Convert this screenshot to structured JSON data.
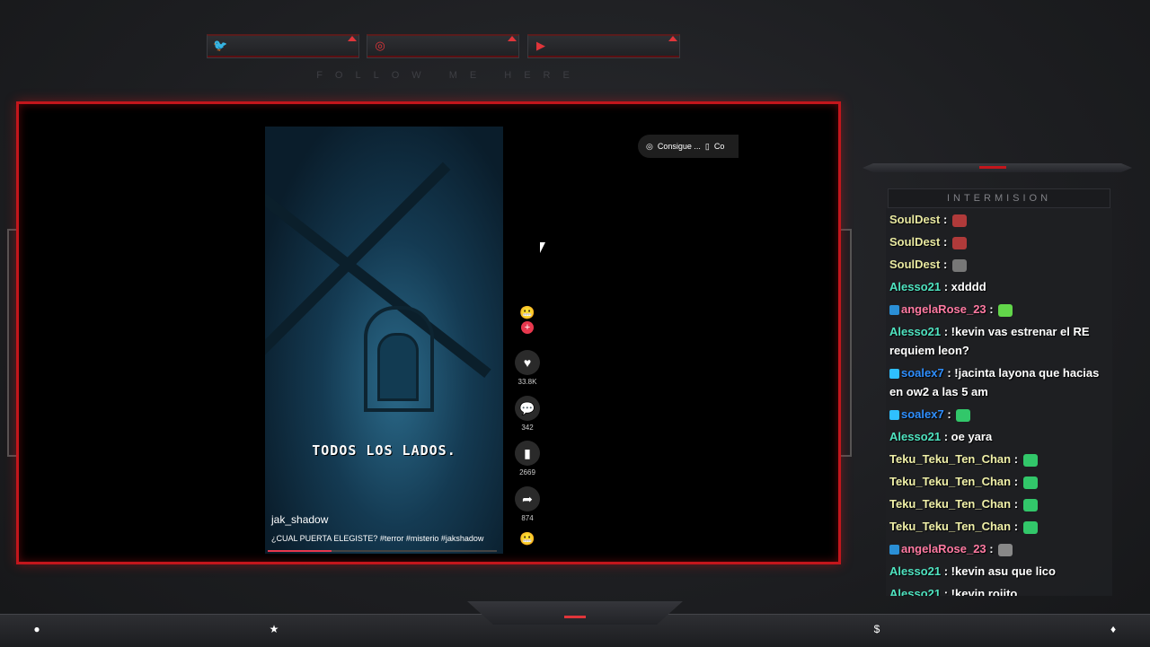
{
  "colors": {
    "frame": "#c3161c",
    "accent": "#e0353a"
  },
  "social": {
    "twitter_icon": "twitter-icon",
    "instagram_icon": "instagram-icon",
    "youtube_icon": "youtube-icon",
    "follow_label": "FOLLOW ME HERE"
  },
  "video": {
    "caption": "TODOS LOS LADOS.",
    "author": "jak_shadow",
    "description": "¿CUAL PUERTA ELEGISTE? #terror #misterio #jakshadow",
    "progress": 0.28,
    "likes": "33.8K",
    "comments": "342",
    "saves": "2669",
    "shares": "874",
    "get_app_label": "Consigue ...",
    "cut_label": "Co"
  },
  "panel": {
    "title": "INTERMISION"
  },
  "chat": [
    {
      "user": "SoulDest",
      "text": "",
      "color": "#e8e8a0",
      "emote": "#b03a3a"
    },
    {
      "user": "SoulDest",
      "text": "",
      "color": "#e8e8a0",
      "emote": "#b03a3a"
    },
    {
      "user": "SoulDest",
      "text": "",
      "color": "#e8e8a0",
      "emote": "#777777"
    },
    {
      "user": "Alesso21",
      "text": "xdddd",
      "color": "#4fe3c0"
    },
    {
      "user": "angelaRose_23",
      "text": "",
      "color": "#ff7aa2",
      "emote": "#62d64a",
      "badge": "#2a8fd6"
    },
    {
      "user": "Alesso21",
      "text": "!kevin vas estrenar el RE requiem leon?",
      "color": "#4fe3c0"
    },
    {
      "user": "soalex7",
      "text": "!jacinta layona que hacias en ow2 a las 5 am",
      "color": "#2f8fff",
      "badge": "#2fc0ff"
    },
    {
      "user": "soalex7",
      "text": "",
      "color": "#2f8fff",
      "badge": "#2fc0ff",
      "emote": "#32c76a"
    },
    {
      "user": "Alesso21",
      "text": "oe yara",
      "color": "#4fe3c0"
    },
    {
      "user": "Teku_Teku_Ten_Chan",
      "text": "",
      "color": "#f0f0a8",
      "emote": "#32c76a"
    },
    {
      "user": "Teku_Teku_Ten_Chan",
      "text": "",
      "color": "#f0f0a8",
      "emote": "#32c76a"
    },
    {
      "user": "Teku_Teku_Ten_Chan",
      "text": "",
      "color": "#f0f0a8",
      "emote": "#32c76a"
    },
    {
      "user": "Teku_Teku_Ten_Chan",
      "text": "",
      "color": "#f0f0a8",
      "emote": "#32c76a"
    },
    {
      "user": "angelaRose_23",
      "text": "",
      "color": "#ff7aa2",
      "emote": "#888888",
      "badge": "#2a8fd6"
    },
    {
      "user": "Alesso21",
      "text": "!kevin asu que lico",
      "color": "#4fe3c0"
    },
    {
      "user": "Alesso21",
      "text": "!kevin rojito",
      "color": "#4fe3c0"
    }
  ]
}
